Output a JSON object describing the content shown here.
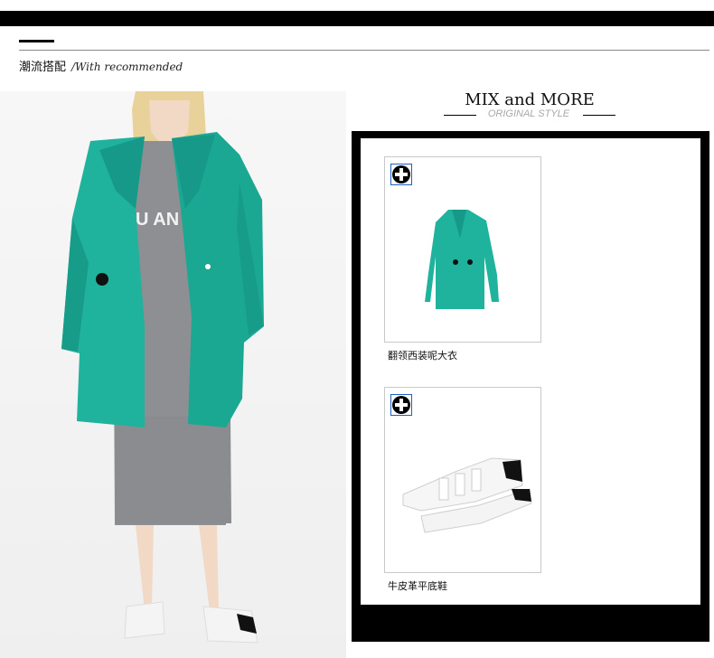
{
  "header": {
    "title": "潮流搭配",
    "subtitle": "/With recommended"
  },
  "mix": {
    "title": "MIX and MORE",
    "subtitle": "ORIGINAL STYLE"
  },
  "products": [
    {
      "name": "翻领西装呢大衣",
      "icon": "coat-image"
    },
    {
      "name": "牛皮革平底鞋",
      "icon": "sneaker-image"
    }
  ],
  "colors": {
    "coat": "#1fb39e",
    "dress": "#8d8f92",
    "frame": "#000000",
    "badge_border": "#1f5fbf"
  }
}
